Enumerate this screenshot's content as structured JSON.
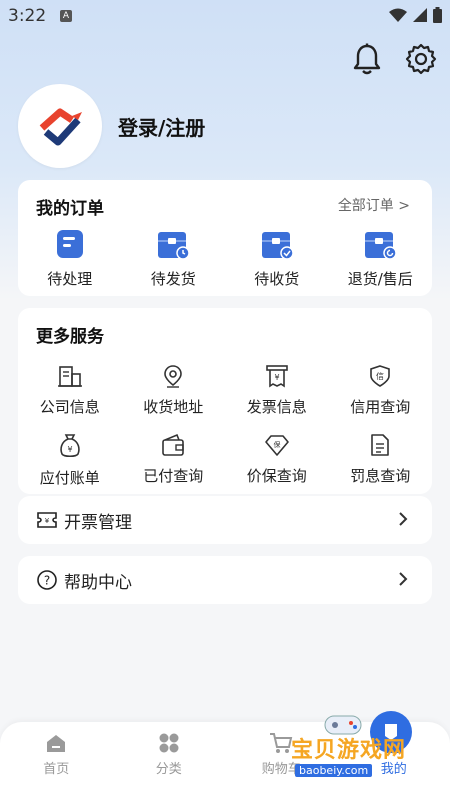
{
  "status": {
    "time": "3:22",
    "indicator": "A"
  },
  "header": {
    "login_text": "登录/注册"
  },
  "orders": {
    "title": "我的订单",
    "all_link": "全部订单 >",
    "items": [
      {
        "label": "待处理",
        "icon": "pending-icon"
      },
      {
        "label": "待发货",
        "icon": "to-ship-icon"
      },
      {
        "label": "待收货",
        "icon": "to-receive-icon"
      },
      {
        "label": "退货/售后",
        "icon": "return-icon"
      }
    ]
  },
  "services": {
    "title": "更多服务",
    "items": [
      {
        "label": "公司信息",
        "icon": "company-icon"
      },
      {
        "label": "收货地址",
        "icon": "location-icon"
      },
      {
        "label": "发票信息",
        "icon": "invoice-icon"
      },
      {
        "label": "信用查询",
        "icon": "credit-icon"
      },
      {
        "label": "应付账单",
        "icon": "bill-icon"
      },
      {
        "label": "已付查询",
        "icon": "wallet-icon"
      },
      {
        "label": "价保查询",
        "icon": "price-protect-icon"
      },
      {
        "label": "罚息查询",
        "icon": "penalty-icon"
      }
    ]
  },
  "rows": {
    "invoice_manage": "开票管理",
    "help_center": "帮助中心"
  },
  "tabbar": {
    "items": [
      {
        "label": "首页"
      },
      {
        "label": "分类"
      },
      {
        "label": "购物车"
      },
      {
        "label": "我的"
      }
    ]
  },
  "watermark": {
    "text": "宝贝游戏网",
    "url": "baobeiy.com"
  },
  "colors": {
    "accent": "#2f6de1",
    "icon_blue": "#3b6fd8",
    "logo_red": "#e8432e"
  }
}
